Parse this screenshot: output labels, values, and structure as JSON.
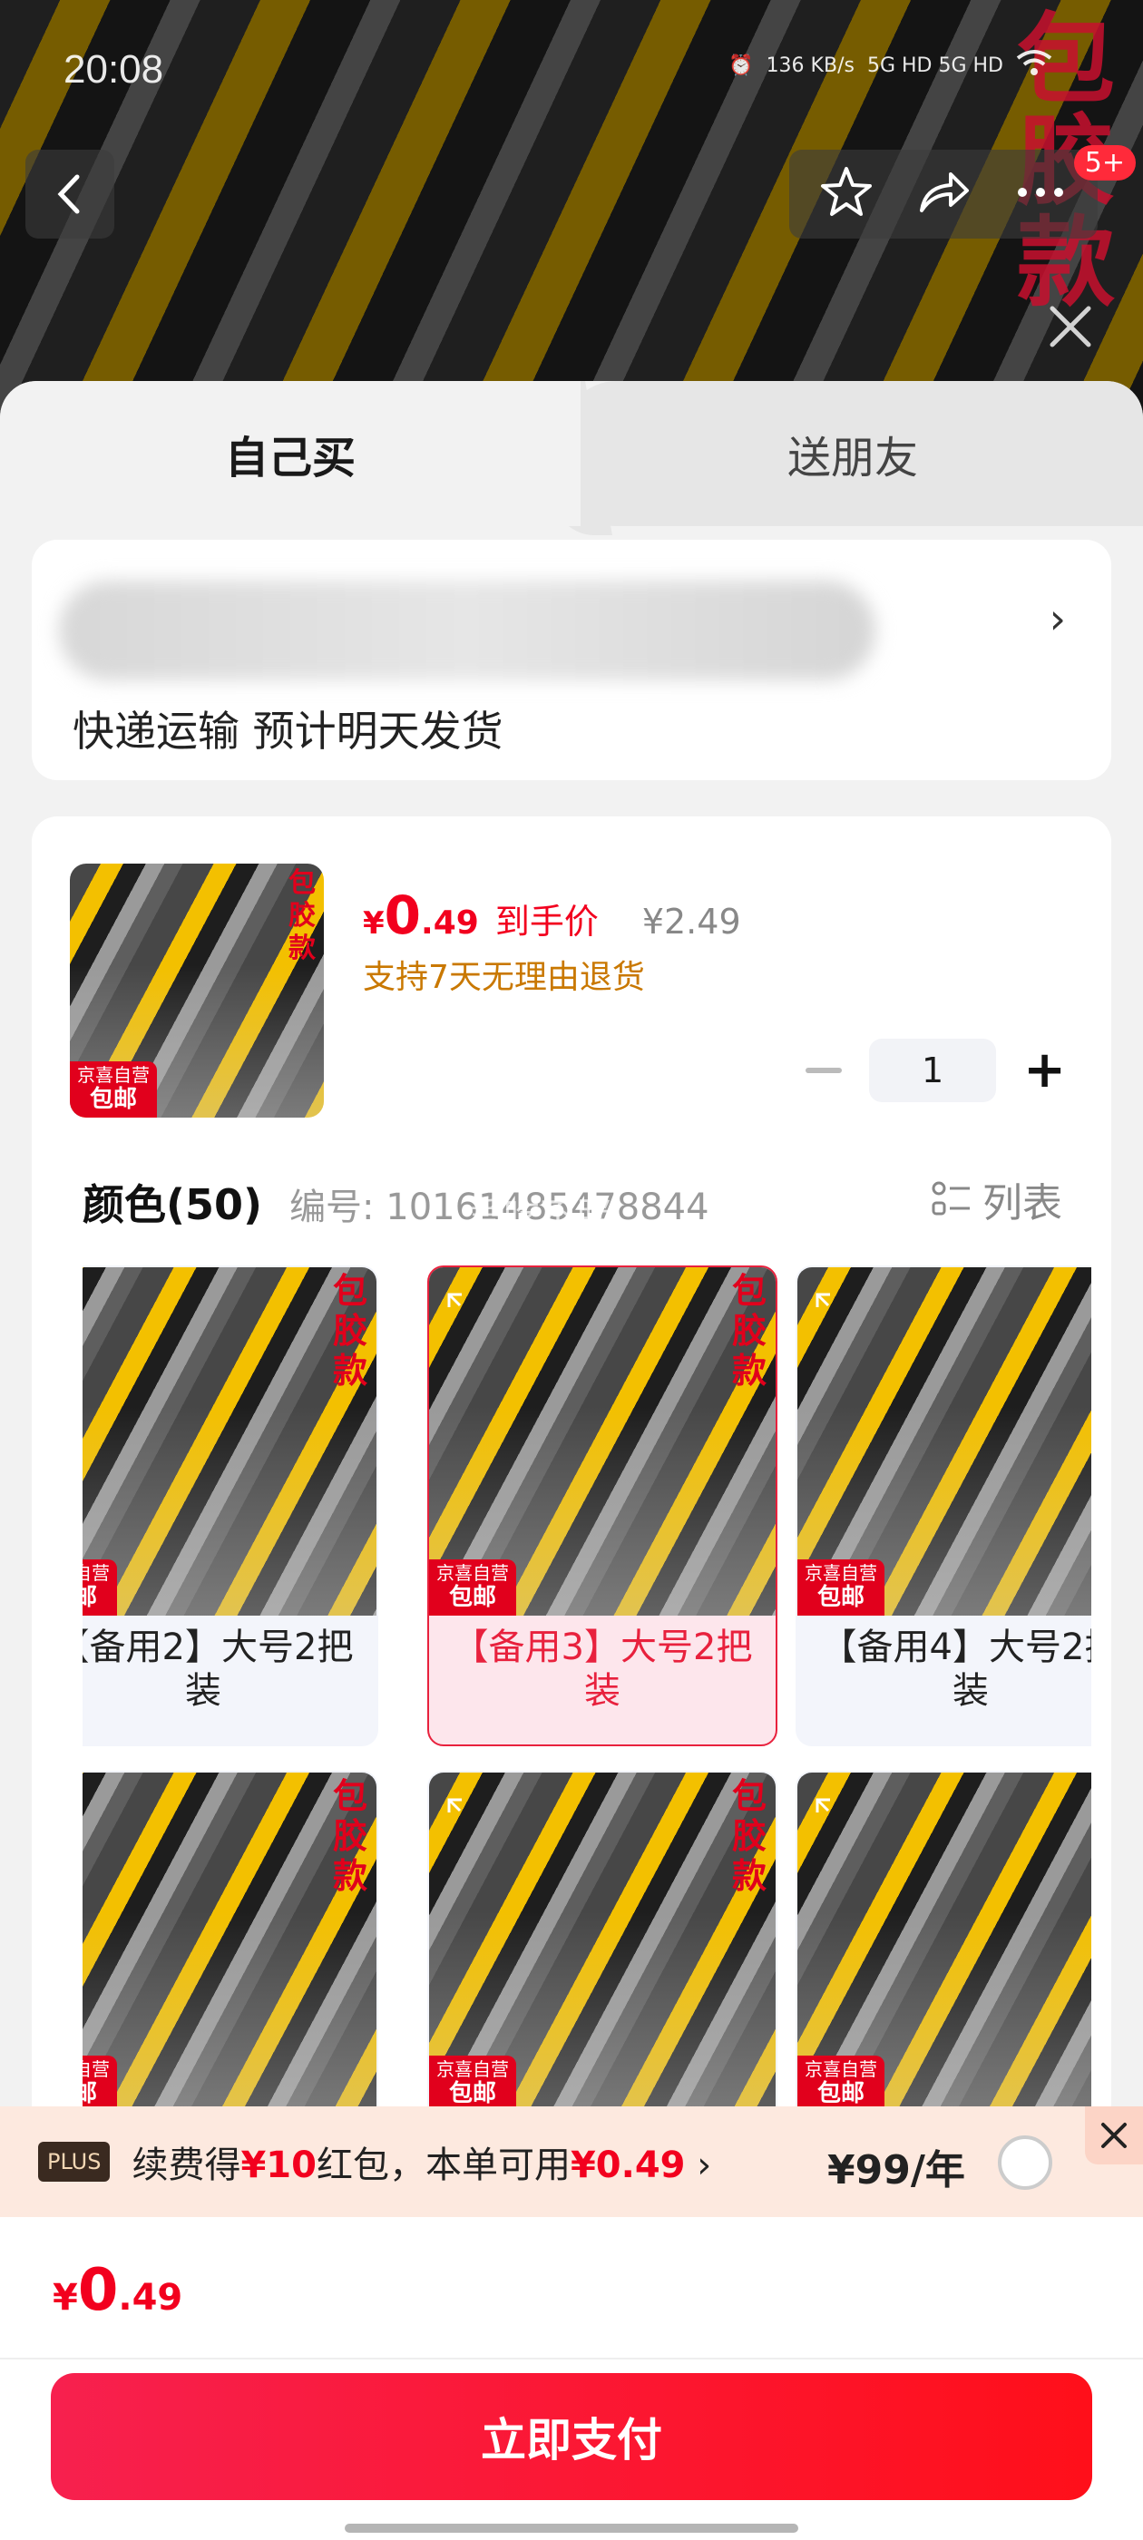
{
  "status_bar": {
    "time": "20:08",
    "net_speed": "136 KB/s",
    "signal": "5G HD 5G HD"
  },
  "hero": {
    "badge_text": "包胶款",
    "cart_count": "5+"
  },
  "tabs": {
    "self": "自己买",
    "friend": "送朋友"
  },
  "address": {
    "shipping_note": "快递运输 预计明天发货"
  },
  "product": {
    "price_symbol": "¥",
    "price_int": "0",
    "price_dec": ".49",
    "price_label": "到手价",
    "original_price": "¥2.49",
    "return_policy": "支持7天无理由退货",
    "quantity": "1",
    "thumb_badge": "包胶款",
    "thumb_tag_top": "京喜自营",
    "thumb_tag_bottom": "包邮"
  },
  "spec": {
    "title": "颜色(50)",
    "code": "编号: 10161485478844",
    "list_label": "列表",
    "watermark": "爱吃不胖",
    "options": [
      {
        "name": "【备用2】大号2把装",
        "selected": false
      },
      {
        "name": "【备用3】大号2把装",
        "selected": true
      },
      {
        "name": "【备用4】大号2把装",
        "selected": false
      },
      {
        "name": "",
        "selected": false
      },
      {
        "name": "",
        "selected": false
      },
      {
        "name": "",
        "selected": false
      }
    ]
  },
  "plus": {
    "badge": "PLUS",
    "text_a": "续费得",
    "text_red1": "¥10",
    "text_b": "红包，本单可用",
    "text_red2": "¥0.49",
    "fee": "¥99/年"
  },
  "footer": {
    "total_symbol": "¥",
    "total_int": "0",
    "total_dec": ".49",
    "pay_label": "立即支付"
  },
  "colors": {
    "accent": "#f2001e",
    "return": "#c97800",
    "plus_bg": "#fde9df"
  }
}
